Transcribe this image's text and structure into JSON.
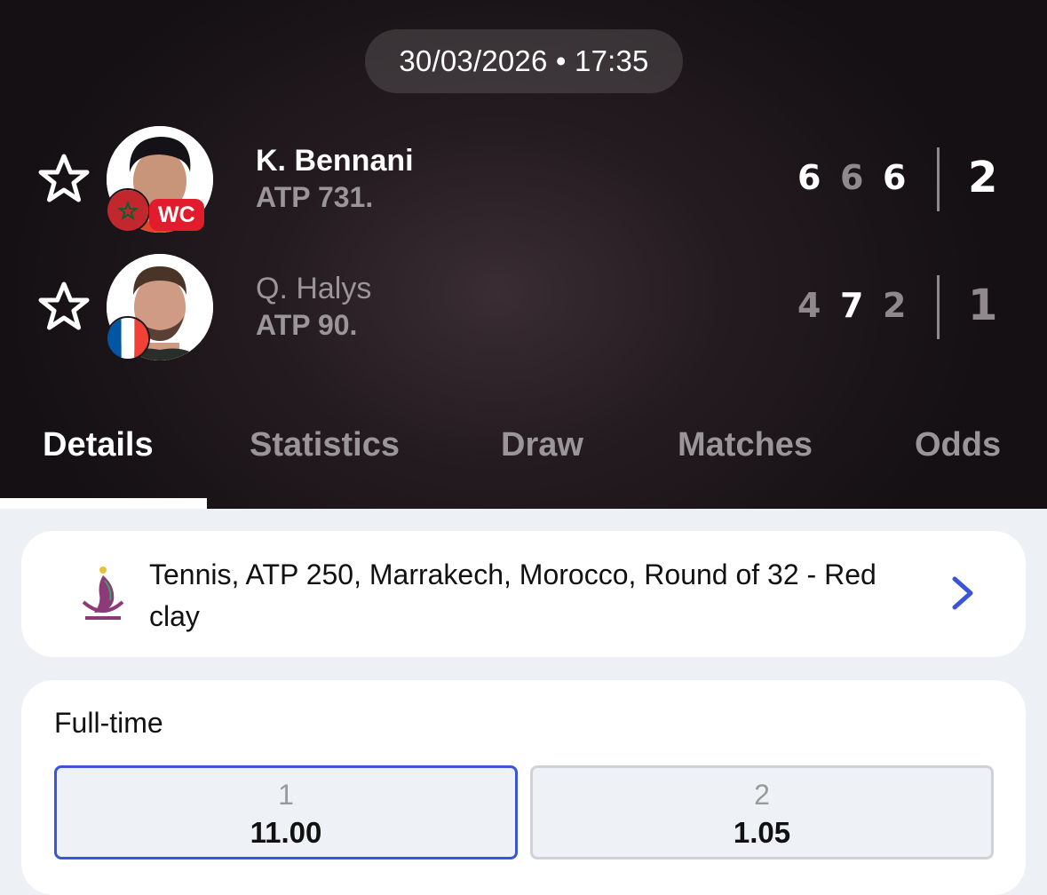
{
  "match": {
    "datetime": "30/03/2026 • 17:35"
  },
  "players": [
    {
      "name": "K. Bennani",
      "rank": "ATP 731.",
      "badge": "WC",
      "flag": "Morocco",
      "sets": [
        "6",
        "6",
        "6"
      ],
      "total": "2"
    },
    {
      "name": "Q. Halys",
      "rank": "ATP 90.",
      "flag": "France",
      "sets": [
        "4",
        "7",
        "2"
      ],
      "total": "1"
    }
  ],
  "tabs": [
    "Details",
    "Statistics",
    "Draw",
    "Matches",
    "Odds"
  ],
  "active_tab": "Details",
  "tournament": {
    "text": "Tennis, ATP 250, Marrakech, Morocco, Round of 32 - Red clay"
  },
  "odds": {
    "title": "Full-time",
    "options": [
      {
        "label": "1",
        "value": "11.00",
        "selected": true
      },
      {
        "label": "2",
        "value": "1.05",
        "selected": false
      }
    ]
  },
  "colors": {
    "accent": "#3a55d9",
    "wc_badge": "#e21c2c",
    "header_bg": "#1a1418"
  },
  "icons": [
    "star-outline-icon",
    "chevron-right-icon",
    "tournament-logo-icon"
  ]
}
